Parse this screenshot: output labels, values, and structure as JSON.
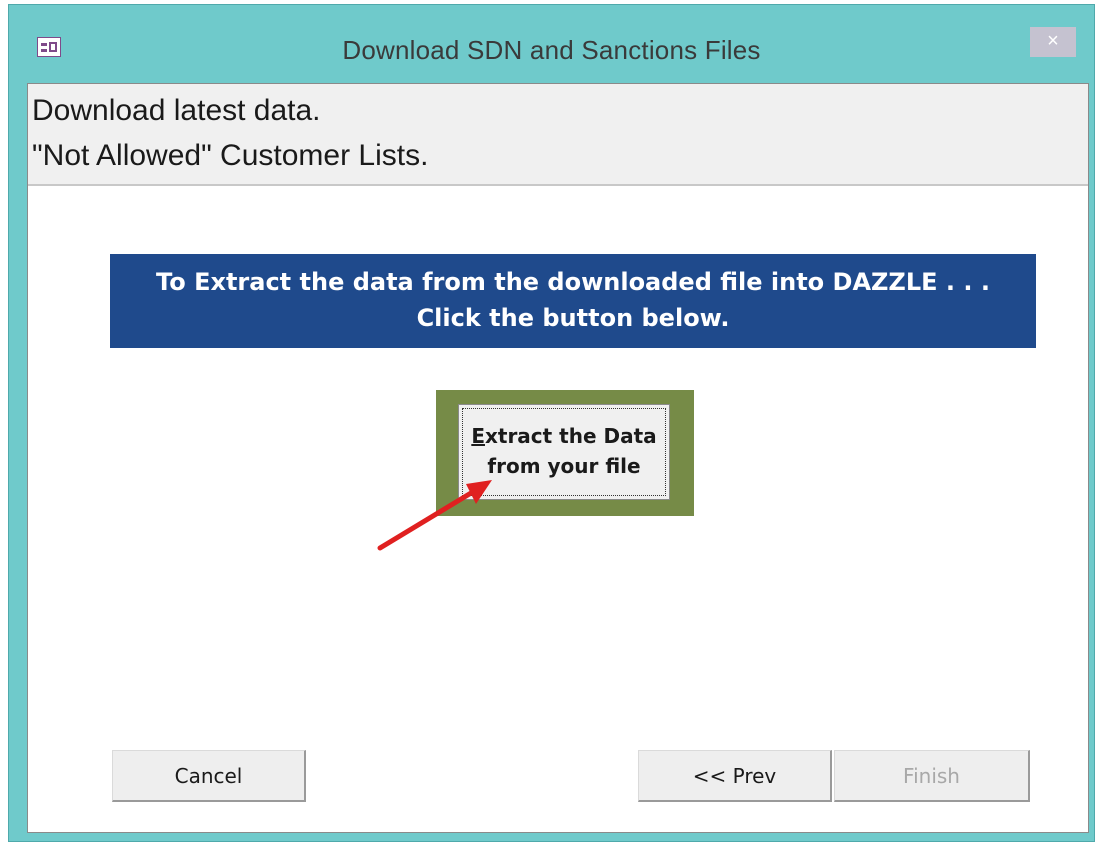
{
  "window": {
    "title": "Download SDN and Sanctions  Files",
    "close_glyph": "×",
    "app_icon": "form-icon"
  },
  "header": {
    "line1": "Download latest data.",
    "line2": "\"Not Allowed\" Customer Lists."
  },
  "banner": {
    "line1": "To Extract the data from the downloaded file into DAZZLE . . .",
    "line2": "Click the button below.",
    "color": "#1f4a8c"
  },
  "extract_button": {
    "accel_char": "E",
    "line1_rest": "xtract the Data",
    "line2": "from your file",
    "frame_color": "#768b47"
  },
  "annotation": {
    "arrow_color": "#e02020"
  },
  "footer": {
    "cancel_label": "Cancel",
    "prev_label": "<< Prev",
    "finish_label": "Finish",
    "finish_enabled": false
  }
}
